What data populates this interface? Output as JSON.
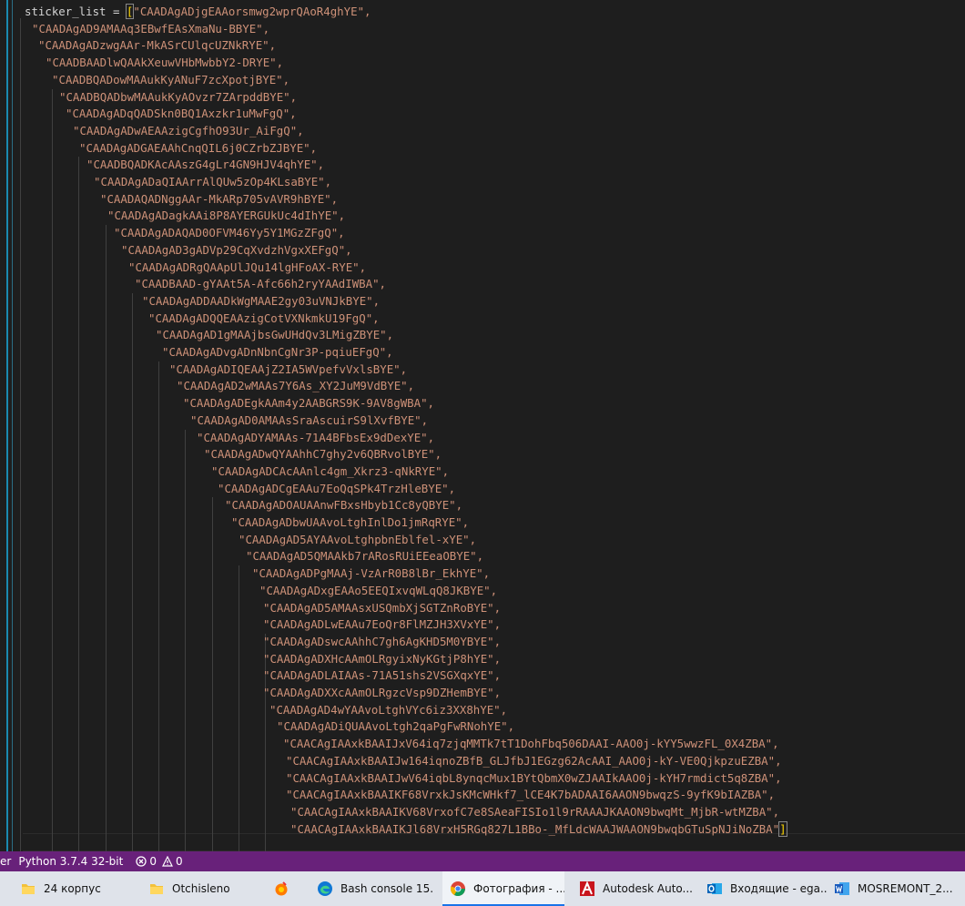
{
  "editor": {
    "variable_name": "sticker_list",
    "assign_op": " = ",
    "open_bracket": "[",
    "close_bracket": "]",
    "lines": [
      "\"CAADAgADjgEAAorsmwg2wprQAoR4ghYE\",",
      "\"CAADAgAD9AMAAq3EBwfEAsXmaNu-BBYE\",",
      "\"CAADAgADzwgAAr-MkASrCUlqcUZNkRYE\",",
      "\"CAADBAADlwQAAkXeuwVHbMwbbY2-DRYE\",",
      "\"CAADBQADowMAAukKyANuF7zcXpotjBYE\",",
      "\"CAADBQADbwMAAukKyAOvzr7ZArpddBYE\",",
      "\"CAADAgADqQADSkn0BQ1Axzkr1uMwFgQ\",",
      "\"CAADAgADwAEAAzigCgfhO93Ur_AiFgQ\",",
      "\"CAADAgADGAEAAhCnqQIL6j0CZrbZJBYE\",",
      "\"CAADBQADKAcAAszG4gLr4GN9HJV4qhYE\",",
      "\"CAADAgADaQIAArrAlQUw5zOp4KLsaBYE\",",
      "\"CAADAQADNggAAr-MkARp705vAVR9hBYE\",",
      "\"CAADAgADagkAAi8P8AYERGUkUc4dIhYE\",",
      "\"CAADAgADAQAD0OFVM46Yy5Y1MGzZFgQ\",",
      "\"CAADAgAD3gADVp29CqXvdzhVgxXEFgQ\",",
      "\"CAADAgADRgQAApUlJQu14lgHFoAX-RYE\",",
      "\"CAADBAAD-gYAAt5A-Afc66h2ryYAAdIWBA\",",
      "\"CAADAgADDAADkWgMAAE2gy03uVNJkBYE\",",
      "\"CAADAgADQQEAAzigCotVXNkmkU19FgQ\",",
      "\"CAADAgAD1gMAAjbsGwUHdQv3LMigZBYE\",",
      "\"CAADAgADvgADnNbnCgNr3P-pqiuEFgQ\",",
      "\"CAADAgADIQEAAjZ2IA5WVpefvVxlsBYE\",",
      "\"CAADAgAD2wMAAs7Y6As_XY2JuM9VdBYE\",",
      "\"CAADAgADEgkAAm4y2AABGRS9K-9AV8gWBA\",",
      "\"CAADAgAD0AMAAsSraAscuirS9lXvfBYE\",",
      "\"CAADAgADYAMAAs-71A4BFbsEx9dDexYE\",",
      "\"CAADAgADwQYAAhhC7ghy2v6QBRvolBYE\",",
      "\"CAADAgADCAcAAnlc4gm_Xkrz3-qNkRYE\",",
      "\"CAADAgADCgEAAu7EoQqSPk4TrzHleBYE\",",
      "\"CAADAgADOAUAAnwFBxsHbyb1Cc8yQBYE\",",
      "\"CAADAgADbwUAAvoLtghInlDo1jmRqRYE\",",
      "\"CAADAgAD5AYAAvoLtghpbnEblfel-xYE\",",
      "\"CAADAgAD5QMAAkb7rARosRUiEEeaOBYE\",",
      "\"CAADAgADPgMAAj-VzArR0B8lBr_EkhYE\",",
      "\"CAADAgADxgEAAo5EEQIxvqWLqQ8JKBYE\",",
      "\"CAADAgAD5AMAAsxUSQmbXjSGTZnRoBYE\",",
      "\"CAADAgADLwEAAu7EoQr8FlMZJH3XVxYE\",",
      "\"CAADAgADswcAAhhC7gh6AgKHD5M0YBYE\",",
      "\"CAADAgADXHcAAmOLRgyixNyKGtjP8hYE\",",
      "\"CAADAgADLAIAAs-71A51shs2VSGXqxYE\",",
      "\"CAADAgADXXcAAmOLRgzcVsp9DZHemBYE\",",
      "\"CAADAgAD4wYAAvoLtghVYc6iz3XX8hYE\",",
      "\"CAADAgADiQUAAvoLtgh2qaPgFwRNohYE\",",
      "\"CAACAgIAAxkBAAIJxV64iq7zjqMMTk7tT1DohFbq506DAAI-AAO0j-kYY5wwzFL_0X4ZBA\",",
      "\"CAACAgIAAxkBAAIJw164iqnoZBfB_GLJfbJ1EGzg62AcAAI_AAO0j-kY-VE0QjkpzuEZBA\",",
      "\"CAACAgIAAxkBAAIJwV64iqbL8ynqcMux1BYtQbmX0wZJAAIkAAO0j-kYH7rmdict5q8ZBA\",",
      "\"CAACAgIAAxkBAAIKF68VrxkJsKMcWHkf7_lCE4K7bADAAI6AAON9bwqzS-9yfK9bIAZBA\",",
      "\"CAACAgIAAxkBAAIKV68VrxofC7e8SAeaFISIo1l9rRAAAJKAAON9bwqMt_MjbR-wtMZBA\",",
      "\"CAACAgIAAxkBAAIKJl68VrxH5RGq827L1BBo-_MfLdcWAAJWAAON9bwqbGTuSpNJiNoZBA\""
    ]
  },
  "statusbar": {
    "left_fragment": "er",
    "python": "Python 3.7.4 32-bit",
    "errors": "0",
    "warnings": "0",
    "color": "#68217a"
  },
  "taskbar": {
    "items": [
      {
        "label": "24 корпус",
        "icon": "folder-icon"
      },
      {
        "label": "Otchisleno",
        "icon": "folder-icon"
      },
      {
        "label": "",
        "icon": "app-icon"
      },
      {
        "label": "Bash console 15...",
        "icon": "edge-icon"
      },
      {
        "label": "Фотография - ...",
        "icon": "chrome-icon"
      },
      {
        "label": "Autodesk Auto...",
        "icon": "autocad-icon"
      },
      {
        "label": "Входящие - ega...",
        "icon": "outlook-icon"
      },
      {
        "label": "MOSREMONT_2...",
        "icon": "word-icon"
      }
    ]
  }
}
